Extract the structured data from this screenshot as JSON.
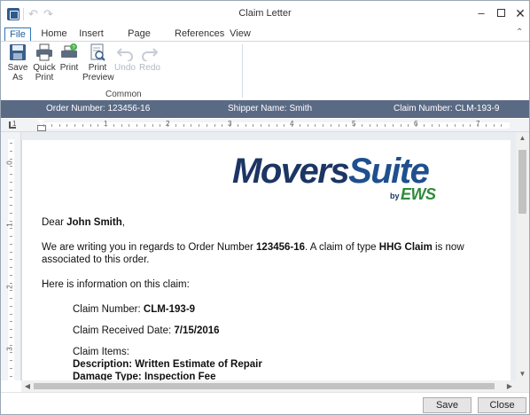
{
  "window": {
    "title": "Claim Letter",
    "minimize_glyph": "–",
    "close_glyph": "✕"
  },
  "ribbon": {
    "tabs": [
      "File",
      "Home",
      "Insert",
      "Page Layout",
      "References",
      "View"
    ],
    "active_tab": "File",
    "collapse_glyph": "⌃",
    "buttons": [
      {
        "label": "Save\nAs",
        "icon": "save-icon",
        "enabled": true
      },
      {
        "label": "Quick\nPrint",
        "icon": "quick-print-icon",
        "enabled": true
      },
      {
        "label": "Print",
        "icon": "print-icon",
        "enabled": true
      },
      {
        "label": "Print\nPreview",
        "icon": "print-preview-icon",
        "enabled": true
      },
      {
        "label": "Undo",
        "icon": "undo-icon",
        "enabled": false
      },
      {
        "label": "Redo",
        "icon": "redo-icon",
        "enabled": false
      }
    ],
    "group_label": "Common"
  },
  "infobar": {
    "order": "Order Number: 123456-16",
    "shipper": "Shipper Name: Smith",
    "claim": "Claim Number: CLM-193-9"
  },
  "ruler": {
    "numbers": [
      "1",
      "1",
      "2",
      "3",
      "4",
      "5",
      "6",
      "7"
    ],
    "vertical_numbers": [
      "0",
      "1",
      "2",
      "3"
    ]
  },
  "logo": {
    "movers": "Movers",
    "suite": "Suite",
    "by": "by",
    "ews": "EWS"
  },
  "letter": {
    "salutation_prefix": "Dear ",
    "name": "John Smith",
    "salutation_suffix": ",",
    "p1_a": "We are writing you in regards to Order Number ",
    "p1_order": "123456-16",
    "p1_b": ". A claim of type ",
    "p1_type": "HHG Claim",
    "p1_c": " is now",
    "p1_line2": "associated to this order.",
    "p2": "Here is information on this claim:",
    "claim_number_label": "Claim Number: ",
    "claim_number": "CLM-193-9",
    "received_label": "Claim Received Date: ",
    "received_date": "7/15/2016",
    "items_label": "Claim Items:",
    "description": "Description: Written Estimate of Repair",
    "damage": "Damage Type: Inspection Fee"
  },
  "footer": {
    "save": "Save",
    "close": "Close"
  },
  "colors": {
    "infobar_bg": "#5a6a85",
    "accent": "#2e75b6",
    "logo_navy": "#1c3563",
    "logo_green": "#2e8b3a"
  }
}
